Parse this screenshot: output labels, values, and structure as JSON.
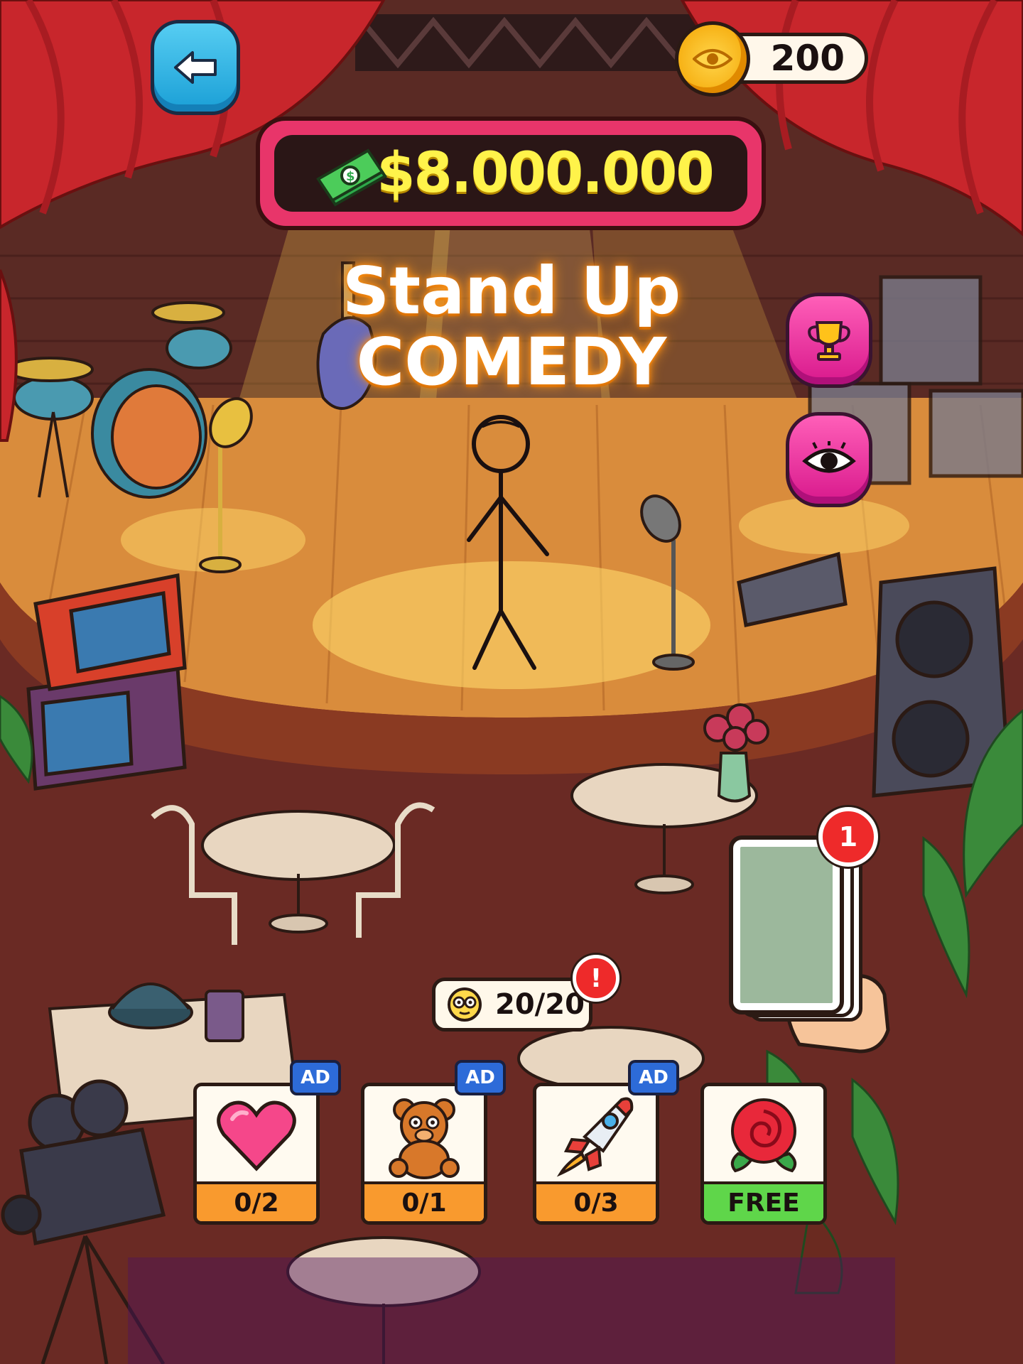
{
  "hud": {
    "coins": "200"
  },
  "venue": {
    "prize": "$8.000.000",
    "title_line1": "Stand Up",
    "title_line2": "COMEDY"
  },
  "side_buttons": {
    "trophy_icon": "trophy-icon",
    "eye_icon": "eye-icon"
  },
  "deck": {
    "badge": "1"
  },
  "energy": {
    "value": "20/20",
    "alert": "!"
  },
  "boosters": [
    {
      "name": "heart",
      "count": "0/2",
      "ad": "AD"
    },
    {
      "name": "teddy-bear",
      "count": "0/1",
      "ad": "AD"
    },
    {
      "name": "rocket",
      "count": "0/3",
      "ad": "AD"
    },
    {
      "name": "rose",
      "count": "FREE"
    }
  ],
  "colors": {
    "curtain": "#c8262c",
    "stage": "#d98c3c",
    "floor": "#6a2a24",
    "money_text": "#fff34a",
    "marquee_frame": "#e8356a"
  }
}
